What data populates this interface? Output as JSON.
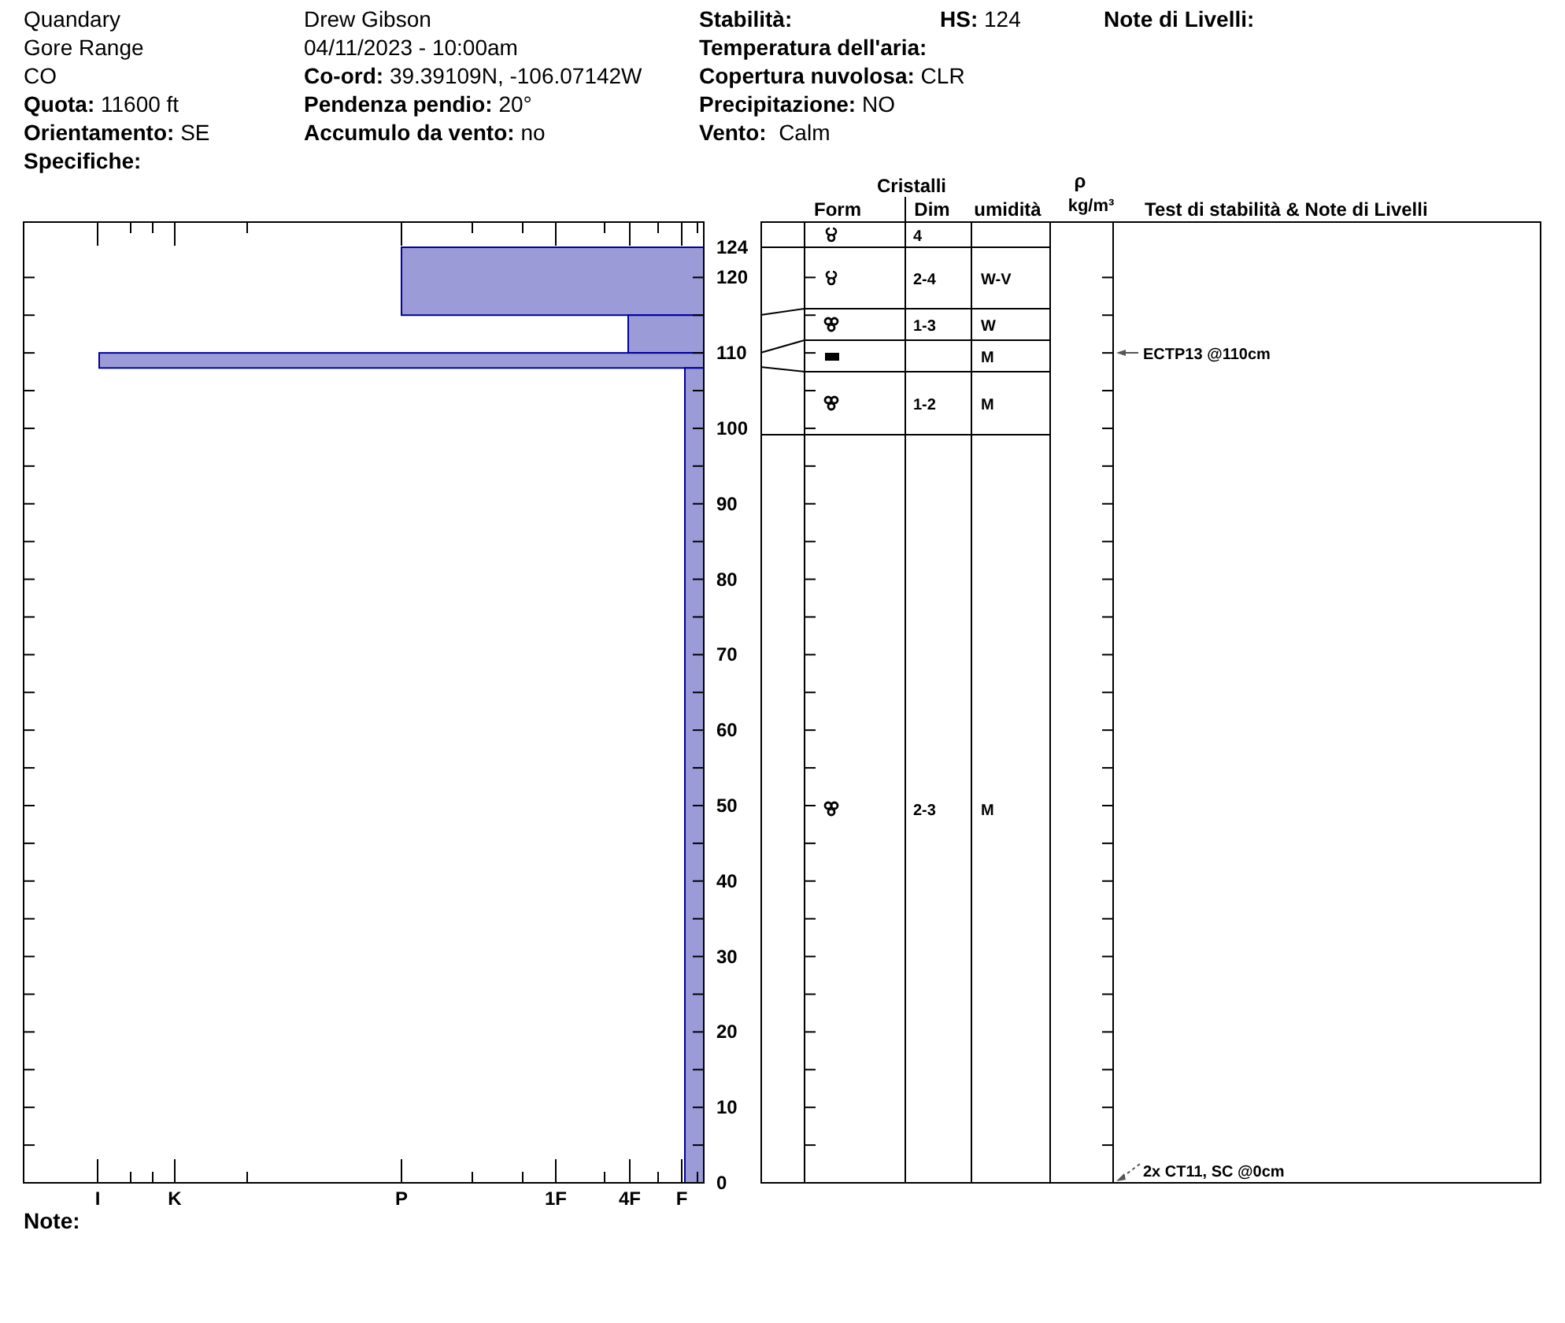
{
  "header": {
    "site": [
      {
        "value": "Quandary"
      },
      {
        "value": "Gore Range"
      },
      {
        "value": "CO"
      },
      {
        "label": "Quota:",
        "value": "11600 ft"
      },
      {
        "label": "Orientamento:",
        "value": "SE"
      },
      {
        "label": "Specifiche:"
      }
    ],
    "observation": [
      {
        "value": "Drew Gibson"
      },
      {
        "value": "04/11/2023 - 10:00am"
      },
      {
        "label": "Co-ord:",
        "value": "39.39109N, -106.07142W"
      },
      {
        "label": "Pendenza pendio:",
        "value": "20°"
      },
      {
        "label": "Accumulo da vento:",
        "value": "no"
      }
    ],
    "conditions": [
      {
        "label": "Stabilità:"
      },
      {
        "label": "Temperatura dell'aria:"
      },
      {
        "label": "Copertura nuvolosa:",
        "value": "CLR"
      },
      {
        "label": "Precipitazione:",
        "value": "NO"
      },
      {
        "label": "Vento:",
        "value": "Calm"
      }
    ],
    "hs": {
      "label": "HS:",
      "value": "124"
    },
    "layer_notes_title": "Note di Livelli:"
  },
  "profile": {
    "layers": [
      {
        "kind": "pencil"
      },
      {
        "kind": "four_finger"
      },
      {
        "kind": "ice"
      },
      {
        "kind": "fist"
      }
    ],
    "hardness_labels": [
      "I",
      "K",
      "P",
      "1F",
      "4F",
      "F"
    ],
    "depth_labels": [
      "124",
      "120",
      "110",
      "100",
      "90",
      "80",
      "70",
      "60",
      "50",
      "40",
      "30",
      "20",
      "10",
      "0"
    ]
  },
  "table": {
    "group_title": "Cristalli",
    "columns": [
      "Form",
      "Dim",
      "umidità"
    ],
    "density_symbol": "ρ",
    "density_unit": "kg/m³",
    "notes_title": "Test di stabilità & Note di Livelli",
    "rows": [
      {
        "kind": "open_cluster",
        "dim": "4"
      },
      {
        "kind": "open_cluster",
        "dim": "2-4",
        "wetness": "W-V"
      },
      {
        "kind": "cluster",
        "dim": "1-3",
        "wetness": "W"
      },
      {
        "kind": "block",
        "wetness": "M"
      },
      {
        "kind": "cluster",
        "dim": "1-2",
        "wetness": "M"
      },
      {
        "kind": "cluster",
        "dim": "2-3",
        "wetness": "M"
      }
    ],
    "stability_notes": [
      {
        "kind": "solid",
        "text": "ECTP13 @110cm"
      },
      {
        "kind": "dashed",
        "text": "2x CT11, SC @0cm"
      }
    ]
  },
  "notes_label": "Note:"
}
